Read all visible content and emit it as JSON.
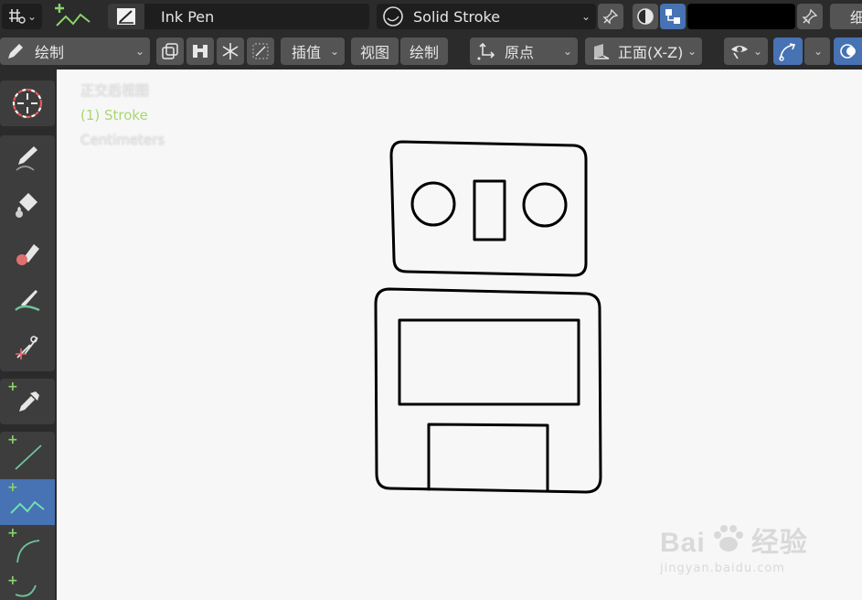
{
  "header": {
    "brush_name": "Ink Pen",
    "material_name": "Solid Stroke",
    "mode_label": "绘制",
    "interpolate_label": "插值",
    "view_label": "视图",
    "draw_label": "绘制",
    "origin_label": "原点",
    "plane_label": "正面(X-Z)",
    "right_edge_label": "细"
  },
  "viewport": {
    "view_name": "正交后视图",
    "object_name": "(1) Stroke",
    "units": "Centimeters"
  },
  "toolbar": {
    "tools": [
      "cursor",
      "draw",
      "fill",
      "erase",
      "tint",
      "cutter",
      "eyedropper",
      "line",
      "polyline",
      "arc",
      "curve"
    ],
    "active_tool": "polyline"
  },
  "colors": {
    "header_bg": "#2b2b2b",
    "field_bg": "#1e1e1e",
    "button_bg": "#545454",
    "active_blue": "#4772b3",
    "viewport_bg": "#f7f7f7",
    "stroke_color": "#000000",
    "overlay_green": "#a8d870"
  },
  "watermark": {
    "brand": "Bai",
    "brand_tail": "经验",
    "url": "jingyan.baidu.com"
  }
}
